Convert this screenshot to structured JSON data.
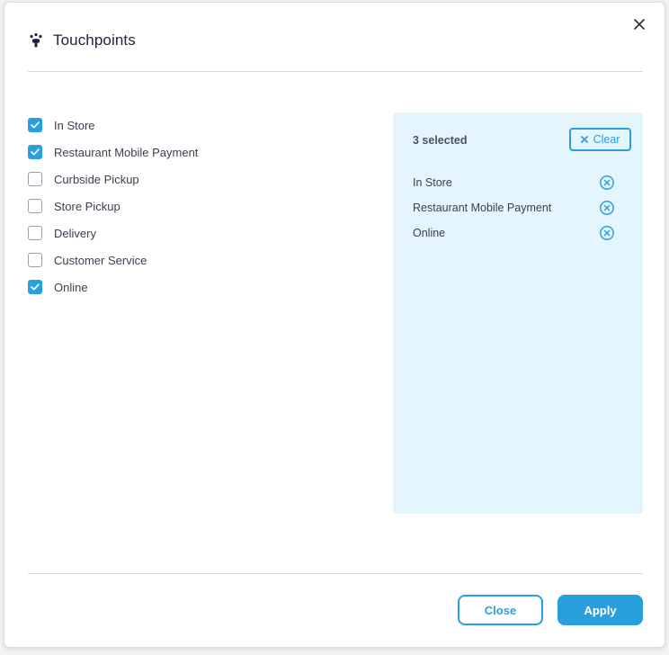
{
  "dialog": {
    "title": "Touchpoints",
    "close_icon": "close-icon",
    "logo_icon": "touchpoints-icon"
  },
  "options": [
    {
      "label": "In Store",
      "checked": true
    },
    {
      "label": "Restaurant Mobile Payment",
      "checked": true
    },
    {
      "label": "Curbside Pickup",
      "checked": false
    },
    {
      "label": "Store Pickup",
      "checked": false
    },
    {
      "label": "Delivery",
      "checked": false
    },
    {
      "label": "Customer Service",
      "checked": false
    },
    {
      "label": "Online",
      "checked": true
    }
  ],
  "selection": {
    "count_label": "3 selected",
    "clear_label": "Clear",
    "items": [
      "In Store",
      "Restaurant Mobile Payment",
      "Online"
    ]
  },
  "footer": {
    "close_label": "Close",
    "apply_label": "Apply"
  },
  "colors": {
    "accent": "#2a9fde",
    "panel_bg": "#e5f5fd",
    "title": "#2c1a3f"
  }
}
